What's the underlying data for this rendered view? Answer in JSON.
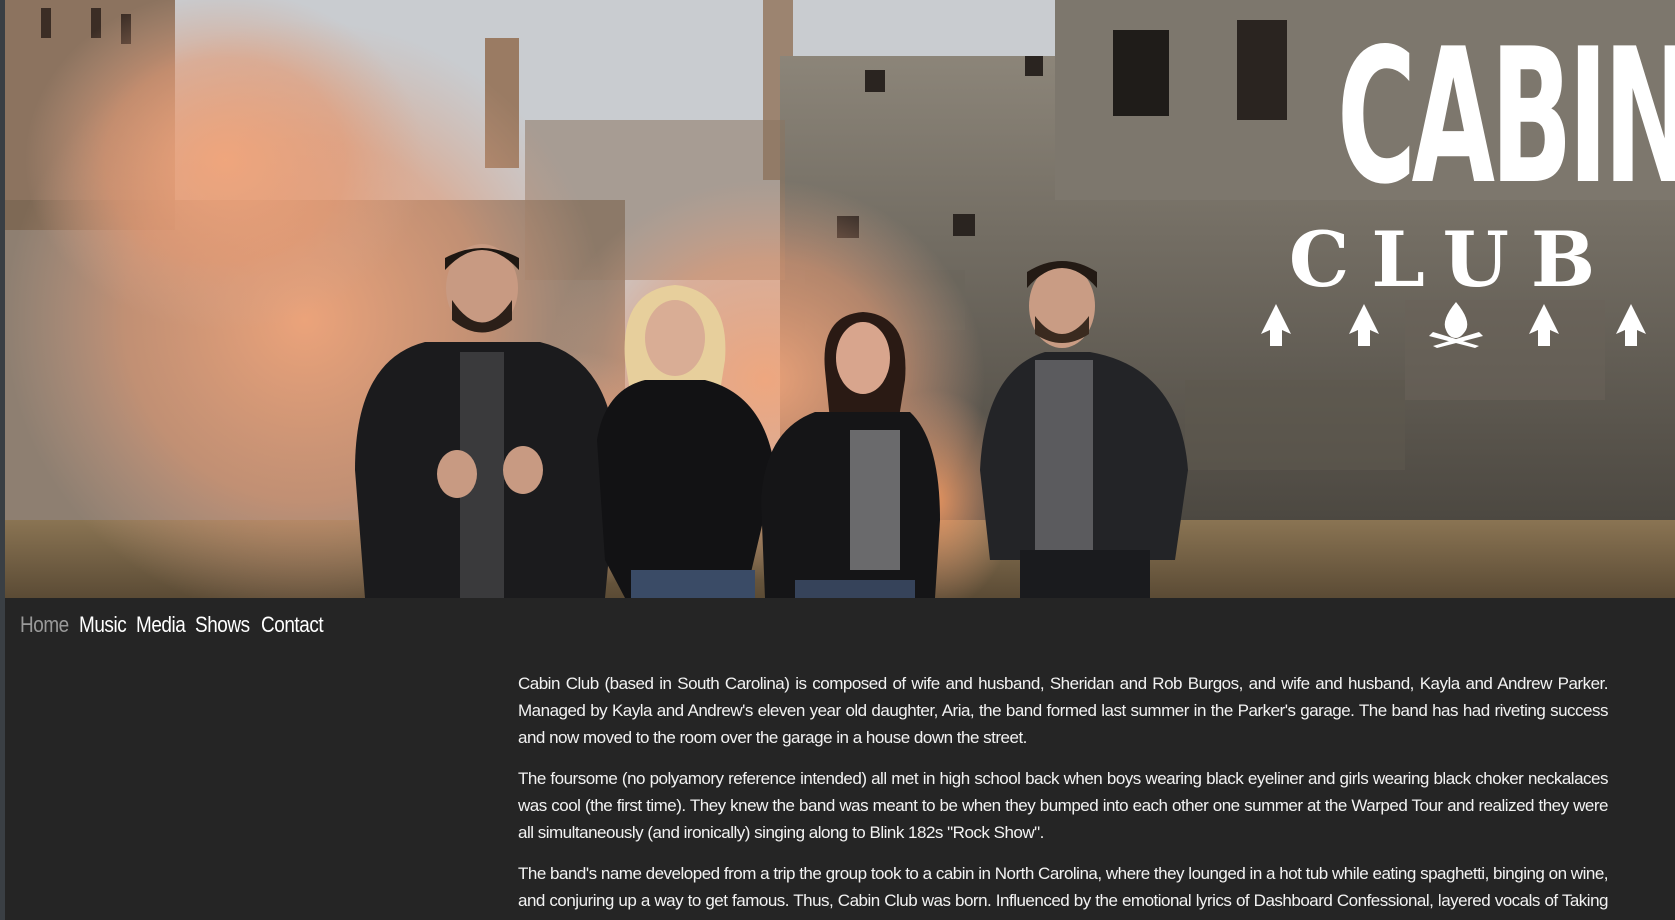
{
  "logo": {
    "line1": "CABIN",
    "line2": "CLUB",
    "icons": [
      "arrow-icon",
      "arrow-icon",
      "campfire-icon",
      "arrow-icon",
      "arrow-icon"
    ]
  },
  "nav": {
    "items": [
      {
        "label": "Home",
        "active": true
      },
      {
        "label": "Music",
        "active": false
      },
      {
        "label": "Media",
        "active": false
      },
      {
        "label": "Shows",
        "active": false
      },
      {
        "label": "Contact",
        "active": false
      }
    ]
  },
  "content": {
    "paragraphs": [
      "Cabin Club (based in South Carolina) is composed of wife and husband, Sheridan and Rob Burgos, and wife and husband, Kayla and Andrew Parker. Managed by Kayla and Andrew's eleven year old daughter, Aria, the band formed last summer in the Parker's garage. The band has had riveting success and now moved to the room over the garage in a house down the street.",
      "The foursome (no polyamory reference intended) all met in high school back when boys wearing black eyeliner and girls wearing black choker neckalaces was cool (the first time). They knew the band was meant to be when they bumped into each other one summer at the Warped Tour and realized they were all simultaneously (and ironically) singing along to Blink 182s \"Rock Show\".",
      "The band's name developed from a trip the group took to a cabin in North Carolina, where they lounged in a hot tub while eating spaghetti, binging on wine, and conjuring up a way to get famous. Thus, Cabin Club was born. Influenced by the emotional lyrics of Dashboard Confessional, layered vocals of Taking Back Sunday, male/female duo vocalists"
    ]
  },
  "colors": {
    "background": "#252525",
    "text": "#f2f2f2",
    "nav_active": "#9a9a9a",
    "nav_default": "#ffffff",
    "logo": "#ffffff",
    "smoke": "#e8a47c"
  }
}
